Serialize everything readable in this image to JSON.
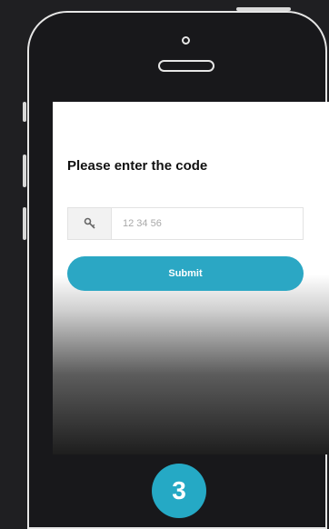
{
  "screen": {
    "title": "Please enter the code",
    "code_input": {
      "value": "12 34 56",
      "icon": "key-icon"
    },
    "submit_label": "Submit"
  },
  "step": {
    "number": "3"
  },
  "colors": {
    "accent": "#2ba7c4",
    "background": "#1f1f22",
    "phone_outline": "#e6e6e6"
  }
}
